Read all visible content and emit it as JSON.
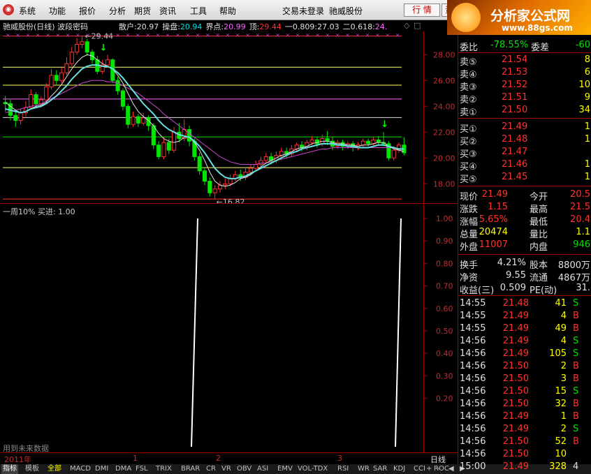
{
  "menu": [
    "系统",
    "功能",
    "报价",
    "分析",
    "期货",
    "资讯",
    "工具",
    "帮助"
  ],
  "status": {
    "trade": "交易未登录",
    "stock": "驰威股份"
  },
  "buttons": {
    "quote": "行 情",
    "info": "资"
  },
  "brand": {
    "name": "分析家公式网",
    "url": "www.88gs.com"
  },
  "title": {
    "stock": "驰威股份(日线) 波段密码",
    "items": [
      {
        "label": "散户:",
        "value": "20.97",
        "color": "#e0e0e0"
      },
      {
        "label": "操盘:",
        "value": "20.94",
        "color": "#00e0e0"
      },
      {
        "label": "界点:",
        "value": "20.99",
        "color": "#ff66ff"
      },
      {
        "label": "顶:",
        "value": "29.44",
        "color": "#ff3232"
      },
      {
        "label": "一0.809:",
        "value": "27.03",
        "color": "#e0e0e0"
      },
      {
        "label": "二0.618:",
        "value": "24.",
        "color": "#ff66ff"
      }
    ]
  },
  "chart_data": {
    "type": "candlestick",
    "ylim": [
      16.5,
      29.8
    ],
    "y_ticks": [
      "28.00",
      "26.00",
      "24.00",
      "22.00",
      "20.00",
      "18.00"
    ],
    "annotations": {
      "high": "29.44",
      "low": "16.82"
    },
    "levels": [
      {
        "value": 29.44,
        "color": "#ff3232"
      },
      {
        "value": 27.03,
        "color": "#ffff66"
      },
      {
        "value": 25.64,
        "color": "#ffff66"
      },
      {
        "value": 24.56,
        "color": "#ff66ff"
      },
      {
        "value": 23.13,
        "color": "#e0e0e0"
      },
      {
        "value": 21.63,
        "color": "#00e600"
      },
      {
        "value": 19.25,
        "color": "#ffff66"
      },
      {
        "value": 16.82,
        "color": "#ff3232"
      }
    ],
    "candles": [
      [
        24.3,
        24.2,
        24.8,
        23.6
      ],
      [
        24.2,
        23.3,
        24.5,
        22.9
      ],
      [
        23.3,
        22.9,
        23.6,
        22.4
      ],
      [
        22.9,
        23.5,
        23.8,
        22.6
      ],
      [
        23.5,
        23.9,
        24.4,
        23.2
      ],
      [
        23.9,
        24.9,
        25.3,
        23.8
      ],
      [
        24.9,
        24.2,
        25.1,
        23.9
      ],
      [
        24.2,
        24.5,
        24.8,
        23.9
      ],
      [
        24.5,
        25.5,
        25.8,
        24.3
      ],
      [
        25.5,
        26.4,
        26.9,
        25.3
      ],
      [
        26.4,
        26.0,
        26.8,
        25.7
      ],
      [
        26.0,
        26.6,
        27.0,
        25.8
      ],
      [
        26.6,
        27.3,
        27.8,
        26.4
      ],
      [
        27.3,
        28.2,
        28.6,
        27.1
      ],
      [
        28.2,
        28.8,
        29.3,
        28.0
      ],
      [
        28.8,
        29.0,
        29.44,
        28.5
      ],
      [
        29.0,
        28.2,
        29.2,
        27.9
      ],
      [
        28.2,
        27.6,
        28.4,
        27.3
      ],
      [
        27.6,
        26.7,
        27.9,
        26.5
      ],
      [
        26.7,
        27.2,
        27.6,
        26.5
      ],
      [
        27.2,
        27.6,
        28.0,
        27.0
      ],
      [
        27.6,
        26.0,
        27.7,
        25.8
      ],
      [
        26.0,
        25.2,
        26.3,
        24.9
      ],
      [
        25.2,
        24.0,
        25.4,
        23.7
      ],
      [
        24.0,
        22.6,
        24.2,
        22.3
      ],
      [
        22.6,
        23.2,
        23.6,
        22.4
      ],
      [
        23.2,
        22.7,
        23.4,
        22.4
      ],
      [
        22.7,
        23.1,
        23.5,
        22.5
      ],
      [
        23.1,
        22.5,
        23.3,
        22.1
      ],
      [
        22.5,
        21.0,
        22.7,
        20.7
      ],
      [
        21.0,
        20.1,
        21.3,
        19.9
      ],
      [
        20.1,
        21.2,
        21.6,
        19.9
      ],
      [
        21.2,
        20.6,
        21.5,
        20.3
      ],
      [
        20.6,
        22.0,
        22.4,
        20.4
      ],
      [
        22.0,
        21.5,
        22.7,
        21.2
      ],
      [
        21.5,
        22.2,
        23.0,
        21.3
      ],
      [
        22.2,
        21.3,
        22.5,
        20.9
      ],
      [
        21.3,
        20.1,
        21.5,
        19.8
      ],
      [
        20.1,
        19.0,
        20.4,
        18.7
      ],
      [
        19.0,
        18.2,
        19.3,
        17.9
      ],
      [
        18.2,
        17.3,
        18.5,
        17.0
      ],
      [
        17.3,
        17.6,
        17.9,
        16.82
      ],
      [
        17.6,
        17.9,
        18.2,
        17.3
      ],
      [
        17.9,
        18.0,
        18.4,
        17.6
      ],
      [
        18.0,
        18.4,
        18.7,
        17.8
      ],
      [
        18.4,
        18.7,
        19.0,
        18.2
      ],
      [
        18.7,
        18.5,
        19.1,
        18.2
      ],
      [
        18.5,
        18.9,
        19.2,
        18.3
      ],
      [
        18.9,
        19.2,
        19.5,
        18.7
      ],
      [
        19.2,
        19.5,
        19.8,
        19.0
      ],
      [
        19.5,
        19.8,
        20.1,
        19.3
      ],
      [
        19.8,
        20.1,
        20.4,
        19.6
      ],
      [
        20.1,
        19.8,
        20.4,
        19.5
      ],
      [
        19.8,
        20.2,
        20.5,
        19.6
      ],
      [
        20.2,
        20.5,
        20.8,
        20.0
      ],
      [
        20.5,
        20.3,
        20.8,
        20.0
      ],
      [
        20.3,
        20.7,
        21.0,
        20.1
      ],
      [
        20.7,
        21.0,
        21.2,
        20.5
      ],
      [
        21.0,
        20.8,
        21.3,
        20.5
      ],
      [
        20.8,
        21.2,
        21.4,
        20.6
      ],
      [
        21.2,
        21.4,
        21.7,
        21.0
      ],
      [
        21.4,
        21.1,
        21.6,
        20.8
      ],
      [
        21.1,
        21.5,
        21.8,
        20.9
      ],
      [
        21.5,
        21.3,
        22.1,
        21.0
      ],
      [
        21.3,
        20.9,
        21.6,
        20.6
      ],
      [
        20.9,
        21.2,
        21.4,
        20.7
      ],
      [
        21.2,
        20.9,
        21.4,
        20.6
      ],
      [
        20.9,
        21.1,
        21.3,
        20.7
      ],
      [
        21.1,
        20.8,
        21.3,
        20.5
      ],
      [
        20.8,
        21.0,
        21.2,
        20.6
      ],
      [
        21.0,
        21.3,
        21.5,
        20.8
      ],
      [
        21.3,
        21.1,
        21.5,
        20.9
      ],
      [
        21.1,
        21.4,
        21.6,
        20.9
      ],
      [
        21.4,
        21.2,
        21.7,
        21.0
      ],
      [
        21.2,
        21.1,
        22.0,
        20.9
      ],
      [
        21.1,
        20.0,
        21.3,
        19.8
      ],
      [
        20.0,
        20.6,
        20.9,
        19.8
      ],
      [
        20.6,
        21.0,
        21.2,
        20.4
      ],
      [
        21.0,
        20.4,
        21.6,
        20.2
      ]
    ],
    "ma_white": [
      24.3,
      24.0,
      23.7,
      23.5,
      23.6,
      23.8,
      24.0,
      24.1,
      24.3,
      24.8,
      25.2,
      25.7,
      26.3,
      26.9,
      27.4,
      27.8,
      28.0,
      27.9,
      27.6,
      27.3,
      27.1,
      26.9,
      26.4,
      25.8,
      25.0,
      24.2,
      23.6,
      23.2,
      22.9,
      22.5,
      21.9,
      21.5,
      21.3,
      21.2,
      21.3,
      21.6,
      21.6,
      21.2,
      20.6,
      19.8,
      18.9,
      18.2,
      17.9,
      17.8,
      17.9,
      18.1,
      18.4,
      18.5,
      18.7,
      19.0,
      19.3,
      19.6,
      19.8,
      20.0,
      20.2,
      20.3,
      20.5,
      20.7,
      20.8,
      20.9,
      21.1,
      21.2,
      21.3,
      21.3,
      21.2,
      21.1,
      21.1,
      21.0,
      21.0,
      20.9,
      21.0,
      21.0,
      21.1,
      21.2,
      21.2,
      20.9,
      20.7,
      20.6,
      20.5
    ],
    "ma_cyan": [
      23.8,
      23.7,
      23.6,
      23.5,
      23.6,
      23.8,
      23.9,
      24.0,
      24.2,
      24.5,
      24.8,
      25.2,
      25.6,
      26.1,
      26.5,
      26.9,
      27.1,
      27.2,
      27.2,
      27.1,
      27.1,
      26.9,
      26.6,
      26.2,
      25.7,
      25.2,
      24.7,
      24.2,
      23.8,
      23.4,
      22.9,
      22.5,
      22.2,
      22.0,
      21.8,
      21.7,
      21.6,
      21.3,
      20.9,
      20.4,
      19.8,
      19.2,
      18.8,
      18.5,
      18.4,
      18.4,
      18.5,
      18.6,
      18.8,
      19.0,
      19.2,
      19.4,
      19.6,
      19.8,
      20.0,
      20.2,
      20.4,
      20.5,
      20.7,
      20.8,
      20.9,
      21.0,
      21.1,
      21.1,
      21.1,
      21.0,
      21.0,
      20.9,
      20.9,
      20.8,
      20.8,
      20.8,
      20.9,
      21.0,
      21.0,
      20.9,
      20.8,
      20.7,
      20.7
    ],
    "ma_magenta": [
      23.5,
      23.6,
      23.7,
      23.8,
      23.9,
      24.0,
      24.1,
      24.2,
      24.4,
      24.6,
      24.8,
      25.0,
      25.2,
      25.4,
      25.6,
      25.8,
      25.9,
      26.0,
      26.0,
      26.0,
      25.9,
      25.9,
      25.8,
      25.6,
      25.4,
      25.2,
      25.0,
      24.7,
      24.4,
      24.1,
      23.8,
      23.4,
      23.1,
      22.8,
      22.5,
      22.2,
      21.9,
      21.6,
      21.3,
      21.0,
      20.7,
      20.4,
      20.1,
      19.9,
      19.7,
      19.6,
      19.5,
      19.5,
      19.5,
      19.5,
      19.6,
      19.6,
      19.7,
      19.8,
      19.9,
      20.0,
      20.1,
      20.2,
      20.3,
      20.4,
      20.5,
      20.6,
      20.7,
      20.7,
      20.8,
      20.8,
      20.8,
      20.8,
      20.8,
      20.8,
      20.8,
      20.8,
      20.8,
      20.8,
      20.8,
      20.8,
      20.8,
      20.7,
      20.7
    ]
  },
  "indicator": {
    "label": "一周10%  买进: 1.00",
    "y_ticks": [
      "1.00",
      "0.90",
      "0.80",
      "0.70",
      "0.60",
      "0.50",
      "0.40",
      "0.30",
      "0.20"
    ],
    "future": "用到未来数据"
  },
  "date_axis": [
    "2011年",
    "1",
    "2",
    "3"
  ],
  "period": "日线",
  "tabs": [
    "指标",
    "模板",
    "全部",
    "MACD",
    "DMI",
    "DMA",
    "FSL",
    "TRIX",
    "BRAR",
    "CR",
    "VR",
    "OBV",
    "ASI",
    "EMV",
    "VOL-TDX",
    "RSI",
    "WR",
    "SAR",
    "KDJ",
    "CCI",
    "ROC"
  ],
  "tab_extra": [
    "+",
    "-",
    "◀",
    "▶"
  ],
  "panel": {
    "weibi": {
      "label": "委比",
      "value": "-78.55%",
      "label2": "委差",
      "value2": "-60"
    },
    "asks": [
      {
        "label": "卖⑤",
        "price": "21.54",
        "vol": "8"
      },
      {
        "label": "卖④",
        "price": "21.53",
        "vol": "6"
      },
      {
        "label": "卖③",
        "price": "21.52",
        "vol": "10"
      },
      {
        "label": "卖②",
        "price": "21.51",
        "vol": "9"
      },
      {
        "label": "卖①",
        "price": "21.50",
        "vol": "34"
      }
    ],
    "bids": [
      {
        "label": "买①",
        "price": "21.49",
        "vol": "1"
      },
      {
        "label": "买②",
        "price": "21.48",
        "vol": "1"
      },
      {
        "label": "买③",
        "price": "21.47",
        "vol": ""
      },
      {
        "label": "买④",
        "price": "21.46",
        "vol": "1"
      },
      {
        "label": "买⑤",
        "price": "21.45",
        "vol": "1"
      }
    ],
    "stats1": [
      {
        "l1": "现价",
        "v1": "21.49",
        "c1": "red",
        "l2": "今开",
        "v2": "20.5",
        "c2": "red"
      },
      {
        "l1": "涨跌",
        "v1": "1.15",
        "c1": "red",
        "l2": "最高",
        "v2": "21.5",
        "c2": "red"
      },
      {
        "l1": "涨幅",
        "v1": "5.65%",
        "c1": "red",
        "l2": "最低",
        "v2": "20.4",
        "c2": "red"
      },
      {
        "l1": "总量",
        "v1": "20474",
        "c1": "yel",
        "l2": "量比",
        "v2": "1.1",
        "c2": "yel"
      },
      {
        "l1": "外盘",
        "v1": "11007",
        "c1": "red",
        "l2": "内盘",
        "v2": "946",
        "c2": "grn"
      }
    ],
    "stats2": [
      {
        "l1": "换手",
        "v1": "4.21%",
        "l2": "股本",
        "v2": "8800万"
      },
      {
        "l1": "净资",
        "v1": "9.55",
        "l2": "流通",
        "v2": "4867万"
      },
      {
        "l1": "收益(三)",
        "v1": "0.509",
        "l2": "PE(动)",
        "v2": "31."
      }
    ],
    "ticks": [
      {
        "t": "14:55",
        "p": "21.48",
        "pc": "red",
        "v": "41",
        "vc": "yel",
        "s": "S",
        "sc": "grn"
      },
      {
        "t": "14:55",
        "p": "21.49",
        "pc": "red",
        "v": "4",
        "vc": "yel",
        "s": "B",
        "sc": "red"
      },
      {
        "t": "14:55",
        "p": "21.49",
        "pc": "red",
        "v": "49",
        "vc": "yel",
        "s": "B",
        "sc": "red"
      },
      {
        "t": "14:56",
        "p": "21.49",
        "pc": "red",
        "v": "4",
        "vc": "yel",
        "s": "S",
        "sc": "grn"
      },
      {
        "t": "14:56",
        "p": "21.49",
        "pc": "red",
        "v": "105",
        "vc": "yel",
        "s": "S",
        "sc": "grn"
      },
      {
        "t": "14:56",
        "p": "21.50",
        "pc": "red",
        "v": "2",
        "vc": "yel",
        "s": "B",
        "sc": "red"
      },
      {
        "t": "14:56",
        "p": "21.50",
        "pc": "red",
        "v": "3",
        "vc": "yel",
        "s": "B",
        "sc": "red"
      },
      {
        "t": "14:56",
        "p": "21.50",
        "pc": "red",
        "v": "15",
        "vc": "yel",
        "s": "S",
        "sc": "grn"
      },
      {
        "t": "14:56",
        "p": "21.50",
        "pc": "red",
        "v": "32",
        "vc": "yel",
        "s": "B",
        "sc": "red"
      },
      {
        "t": "14:56",
        "p": "21.49",
        "pc": "red",
        "v": "1",
        "vc": "yel",
        "s": "B",
        "sc": "red"
      },
      {
        "t": "14:56",
        "p": "21.49",
        "pc": "red",
        "v": "2",
        "vc": "yel",
        "s": "S",
        "sc": "grn"
      },
      {
        "t": "14:56",
        "p": "21.50",
        "pc": "red",
        "v": "52",
        "vc": "yel",
        "s": "B",
        "sc": "red"
      },
      {
        "t": "14:56",
        "p": "21.50",
        "pc": "red",
        "v": "10",
        "vc": "yel",
        "s": "",
        "sc": "red"
      },
      {
        "t": "15:00",
        "p": "21.49",
        "pc": "red",
        "v": "328",
        "vc": "yel",
        "s": "4",
        "sc": "wht"
      }
    ]
  }
}
